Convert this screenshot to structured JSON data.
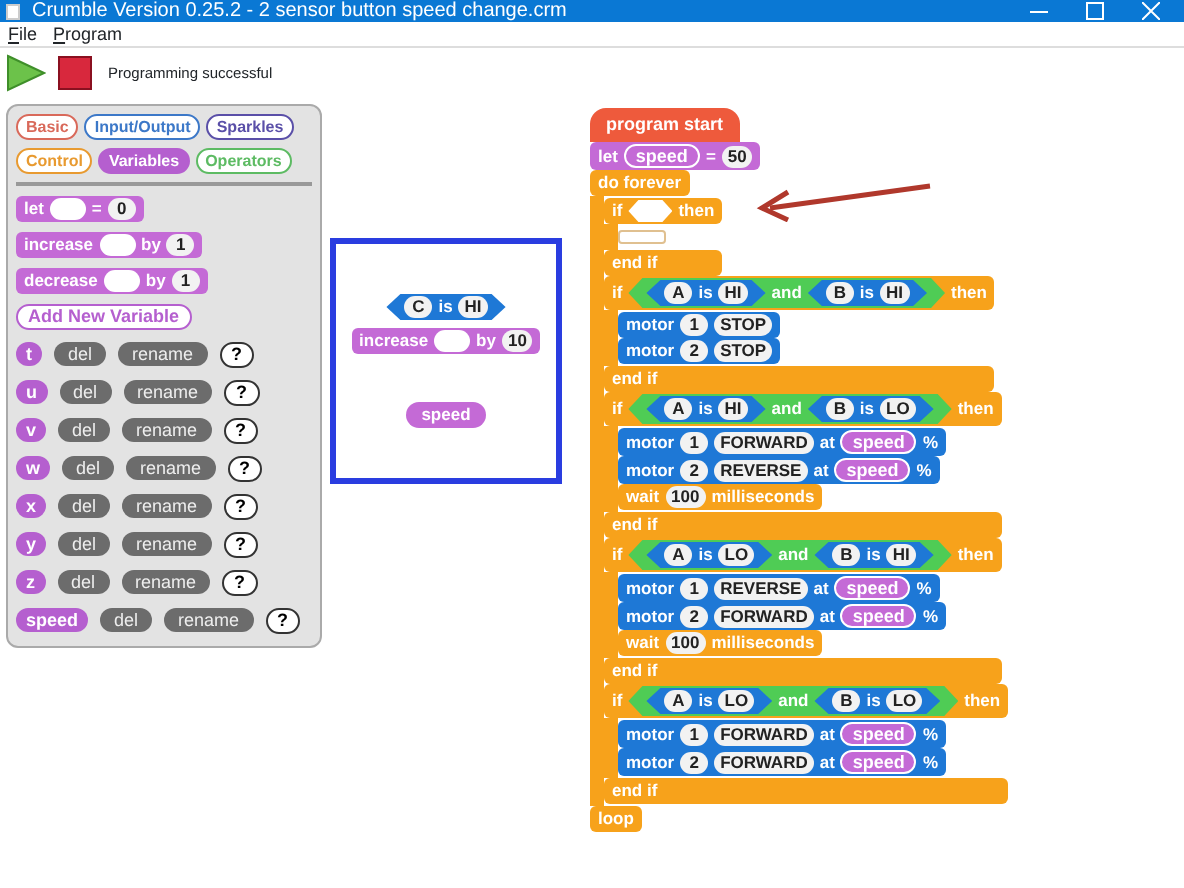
{
  "window": {
    "title": "Crumble Version 0.25.2 - 2 sensor button speed change.crm"
  },
  "menu": [
    {
      "label": "File"
    },
    {
      "label": "Program"
    }
  ],
  "toolbar": {
    "status": "Programming successful"
  },
  "palette": {
    "categories": [
      {
        "label": "Basic",
        "color": "#d9695a",
        "selected": false
      },
      {
        "label": "Input/Output",
        "color": "#3c78c8",
        "selected": false
      },
      {
        "label": "Sparkles",
        "color": "#5a4fa8",
        "selected": false
      },
      {
        "label": "Control",
        "color": "#e89a30",
        "selected": false
      },
      {
        "label": "Variables",
        "color": "#b55fcf",
        "selected": true
      },
      {
        "label": "Operators",
        "color": "#5dbb63",
        "selected": false
      }
    ],
    "blocks": [
      {
        "kind": "variables",
        "parts": [
          {
            "kind": "word",
            "text": "let"
          },
          {
            "kind": "slot"
          },
          {
            "kind": "word",
            "text": "="
          },
          {
            "kind": "slot",
            "text": "0"
          }
        ]
      },
      {
        "kind": "variables",
        "parts": [
          {
            "kind": "word",
            "text": "increase"
          },
          {
            "kind": "slot"
          },
          {
            "kind": "word",
            "text": "by"
          },
          {
            "kind": "slot",
            "text": "1"
          }
        ]
      },
      {
        "kind": "variables",
        "parts": [
          {
            "kind": "word",
            "text": "decrease"
          },
          {
            "kind": "slot"
          },
          {
            "kind": "word",
            "text": "by"
          },
          {
            "kind": "slot",
            "text": "1"
          }
        ]
      }
    ],
    "add_button": "Add New Variable",
    "variables": [
      {
        "name": "t",
        "del": "del",
        "rename": "rename",
        "help": "?"
      },
      {
        "name": "u",
        "del": "del",
        "rename": "rename",
        "help": "?"
      },
      {
        "name": "v",
        "del": "del",
        "rename": "rename",
        "help": "?"
      },
      {
        "name": "w",
        "del": "del",
        "rename": "rename",
        "help": "?"
      },
      {
        "name": "x",
        "del": "del",
        "rename": "rename",
        "help": "?"
      },
      {
        "name": "y",
        "del": "del",
        "rename": "rename",
        "help": "?"
      },
      {
        "name": "z",
        "del": "del",
        "rename": "rename",
        "help": "?"
      },
      {
        "name": "speed",
        "del": "del",
        "rename": "rename",
        "help": "?"
      }
    ]
  },
  "workspace": {
    "loose": [
      {
        "kind": "compare",
        "parts": [
          {
            "kind": "slot",
            "text": "C"
          },
          {
            "kind": "word",
            "text": "is"
          },
          {
            "kind": "slot",
            "text": "HI"
          }
        ]
      },
      {
        "kind": "variables",
        "parts": [
          {
            "kind": "word",
            "text": "increase"
          },
          {
            "kind": "slot"
          },
          {
            "kind": "word",
            "text": "by"
          },
          {
            "kind": "slot",
            "text": "10"
          }
        ]
      },
      {
        "kind": "var",
        "parts": [
          {
            "kind": "word",
            "text": "speed"
          }
        ]
      }
    ],
    "script": {
      "hat": "program start",
      "blocks": [
        {
          "kind": "variables",
          "parts": [
            {
              "kind": "word",
              "text": "let"
            },
            {
              "kind": "var",
              "text": "speed"
            },
            {
              "kind": "word",
              "text": "="
            },
            {
              "kind": "slot",
              "text": "50"
            }
          ]
        },
        {
          "kind": "forever",
          "parts": [
            {
              "kind": "word",
              "text": "do forever"
            }
          ],
          "end": "loop",
          "children": [
            {
              "kind": "if",
              "parts": [
                {
                  "kind": "word",
                  "text": "if"
                },
                {
                  "kind": "hex_slot"
                },
                {
                  "kind": "word",
                  "text": "then"
                }
              ],
              "end": "end if"
            },
            {
              "kind": "if",
              "parts": [
                {
                  "kind": "word",
                  "text": "if"
                },
                {
                  "kind": "and",
                  "parts": [
                    {
                      "kind": "compare",
                      "parts": [
                        {
                          "kind": "slot",
                          "text": "A"
                        },
                        {
                          "kind": "word",
                          "text": "is"
                        },
                        {
                          "kind": "slot",
                          "text": "HI"
                        }
                      ]
                    },
                    {
                      "kind": "word",
                      "text": "and"
                    },
                    {
                      "kind": "compare",
                      "parts": [
                        {
                          "kind": "slot",
                          "text": "B"
                        },
                        {
                          "kind": "word",
                          "text": "is"
                        },
                        {
                          "kind": "slot",
                          "text": "HI"
                        }
                      ]
                    }
                  ]
                },
                {
                  "kind": "word",
                  "text": "then"
                }
              ],
              "end": "end if",
              "children": [
                {
                  "kind": "motor",
                  "parts": [
                    {
                      "kind": "word",
                      "text": "motor"
                    },
                    {
                      "kind": "slot",
                      "text": "1"
                    },
                    {
                      "kind": "slot",
                      "text": "STOP"
                    }
                  ]
                },
                {
                  "kind": "motor",
                  "parts": [
                    {
                      "kind": "word",
                      "text": "motor"
                    },
                    {
                      "kind": "slot",
                      "text": "2"
                    },
                    {
                      "kind": "slot",
                      "text": "STOP"
                    }
                  ]
                }
              ]
            },
            {
              "kind": "if",
              "parts": [
                {
                  "kind": "word",
                  "text": "if"
                },
                {
                  "kind": "and",
                  "parts": [
                    {
                      "kind": "compare",
                      "parts": [
                        {
                          "kind": "slot",
                          "text": "A"
                        },
                        {
                          "kind": "word",
                          "text": "is"
                        },
                        {
                          "kind": "slot",
                          "text": "HI"
                        }
                      ]
                    },
                    {
                      "kind": "word",
                      "text": "and"
                    },
                    {
                      "kind": "compare",
                      "parts": [
                        {
                          "kind": "slot",
                          "text": "B"
                        },
                        {
                          "kind": "word",
                          "text": "is"
                        },
                        {
                          "kind": "slot",
                          "text": "LO"
                        }
                      ]
                    }
                  ]
                },
                {
                  "kind": "word",
                  "text": "then"
                }
              ],
              "end": "end if",
              "children": [
                {
                  "kind": "motor",
                  "parts": [
                    {
                      "kind": "word",
                      "text": "motor"
                    },
                    {
                      "kind": "slot",
                      "text": "1"
                    },
                    {
                      "kind": "slot",
                      "text": "FORWARD"
                    },
                    {
                      "kind": "word",
                      "text": "at"
                    },
                    {
                      "kind": "var",
                      "text": "speed"
                    },
                    {
                      "kind": "word",
                      "text": "%"
                    }
                  ]
                },
                {
                  "kind": "motor",
                  "parts": [
                    {
                      "kind": "word",
                      "text": "motor"
                    },
                    {
                      "kind": "slot",
                      "text": "2"
                    },
                    {
                      "kind": "slot",
                      "text": "REVERSE"
                    },
                    {
                      "kind": "word",
                      "text": "at"
                    },
                    {
                      "kind": "var",
                      "text": "speed"
                    },
                    {
                      "kind": "word",
                      "text": "%"
                    }
                  ]
                },
                {
                  "kind": "wait",
                  "parts": [
                    {
                      "kind": "word",
                      "text": "wait"
                    },
                    {
                      "kind": "slot",
                      "text": "100"
                    },
                    {
                      "kind": "word",
                      "text": "milliseconds"
                    }
                  ]
                }
              ]
            },
            {
              "kind": "if",
              "parts": [
                {
                  "kind": "word",
                  "text": "if"
                },
                {
                  "kind": "and",
                  "parts": [
                    {
                      "kind": "compare",
                      "parts": [
                        {
                          "kind": "slot",
                          "text": "A"
                        },
                        {
                          "kind": "word",
                          "text": "is"
                        },
                        {
                          "kind": "slot",
                          "text": "LO"
                        }
                      ]
                    },
                    {
                      "kind": "word",
                      "text": "and"
                    },
                    {
                      "kind": "compare",
                      "parts": [
                        {
                          "kind": "slot",
                          "text": "B"
                        },
                        {
                          "kind": "word",
                          "text": "is"
                        },
                        {
                          "kind": "slot",
                          "text": "HI"
                        }
                      ]
                    }
                  ]
                },
                {
                  "kind": "word",
                  "text": "then"
                }
              ],
              "end": "end if",
              "children": [
                {
                  "kind": "motor",
                  "parts": [
                    {
                      "kind": "word",
                      "text": "motor"
                    },
                    {
                      "kind": "slot",
                      "text": "1"
                    },
                    {
                      "kind": "slot",
                      "text": "REVERSE"
                    },
                    {
                      "kind": "word",
                      "text": "at"
                    },
                    {
                      "kind": "var",
                      "text": "speed"
                    },
                    {
                      "kind": "word",
                      "text": "%"
                    }
                  ]
                },
                {
                  "kind": "motor",
                  "parts": [
                    {
                      "kind": "word",
                      "text": "motor"
                    },
                    {
                      "kind": "slot",
                      "text": "2"
                    },
                    {
                      "kind": "slot",
                      "text": "FORWARD"
                    },
                    {
                      "kind": "word",
                      "text": "at"
                    },
                    {
                      "kind": "var",
                      "text": "speed"
                    },
                    {
                      "kind": "word",
                      "text": "%"
                    }
                  ]
                },
                {
                  "kind": "wait",
                  "parts": [
                    {
                      "kind": "word",
                      "text": "wait"
                    },
                    {
                      "kind": "slot",
                      "text": "100"
                    },
                    {
                      "kind": "word",
                      "text": "milliseconds"
                    }
                  ]
                }
              ]
            },
            {
              "kind": "if",
              "parts": [
                {
                  "kind": "word",
                  "text": "if"
                },
                {
                  "kind": "and",
                  "parts": [
                    {
                      "kind": "compare",
                      "parts": [
                        {
                          "kind": "slot",
                          "text": "A"
                        },
                        {
                          "kind": "word",
                          "text": "is"
                        },
                        {
                          "kind": "slot",
                          "text": "LO"
                        }
                      ]
                    },
                    {
                      "kind": "word",
                      "text": "and"
                    },
                    {
                      "kind": "compare",
                      "parts": [
                        {
                          "kind": "slot",
                          "text": "B"
                        },
                        {
                          "kind": "word",
                          "text": "is"
                        },
                        {
                          "kind": "slot",
                          "text": "LO"
                        }
                      ]
                    }
                  ]
                },
                {
                  "kind": "word",
                  "text": "then"
                }
              ],
              "end": "end if",
              "children": [
                {
                  "kind": "motor",
                  "parts": [
                    {
                      "kind": "word",
                      "text": "motor"
                    },
                    {
                      "kind": "slot",
                      "text": "1"
                    },
                    {
                      "kind": "slot",
                      "text": "FORWARD"
                    },
                    {
                      "kind": "word",
                      "text": "at"
                    },
                    {
                      "kind": "var",
                      "text": "speed"
                    },
                    {
                      "kind": "word",
                      "text": "%"
                    }
                  ]
                },
                {
                  "kind": "motor",
                  "parts": [
                    {
                      "kind": "word",
                      "text": "motor"
                    },
                    {
                      "kind": "slot",
                      "text": "2"
                    },
                    {
                      "kind": "slot",
                      "text": "FORWARD"
                    },
                    {
                      "kind": "word",
                      "text": "at"
                    },
                    {
                      "kind": "var",
                      "text": "speed"
                    },
                    {
                      "kind": "word",
                      "text": "%"
                    }
                  ]
                }
              ]
            }
          ]
        }
      ]
    }
  }
}
